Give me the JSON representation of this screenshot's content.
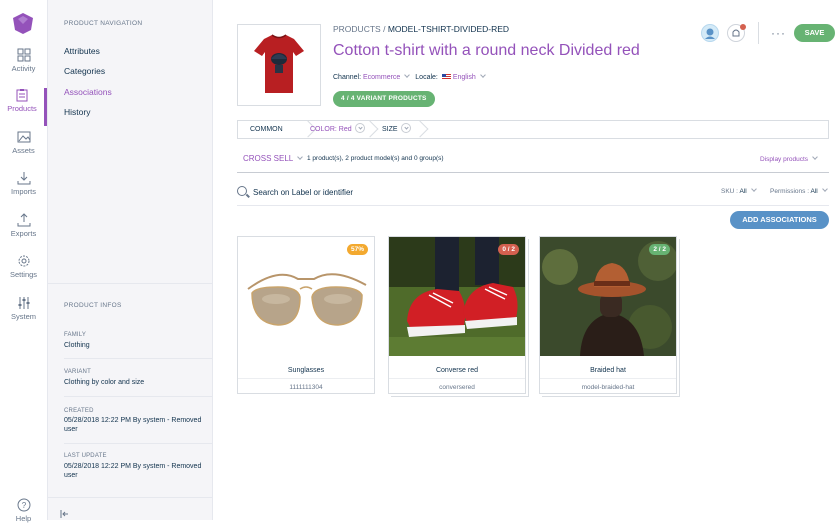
{
  "rail": {
    "items": [
      {
        "label": "Activity"
      },
      {
        "label": "Products"
      },
      {
        "label": "Assets"
      },
      {
        "label": "Imports"
      },
      {
        "label": "Exports"
      },
      {
        "label": "Settings"
      },
      {
        "label": "System"
      }
    ],
    "help": "Help"
  },
  "sidebar": {
    "nav_title": "PRODUCT NAVIGATION",
    "nav": [
      "Attributes",
      "Categories",
      "Associations",
      "History"
    ],
    "infos_title": "PRODUCT INFOS",
    "infos": [
      {
        "label": "FAMILY",
        "value": "Clothing"
      },
      {
        "label": "VARIANT",
        "value": "Clothing by color and size"
      },
      {
        "label": "CREATED",
        "value": "05/28/2018 12:22 PM By system - Removed user"
      },
      {
        "label": "LAST UPDATE",
        "value": "05/28/2018 12:22 PM By system - Removed user"
      }
    ]
  },
  "header": {
    "breadcrumb_root": "PRODUCTS",
    "breadcrumb_sep": "/",
    "breadcrumb_current": "MODEL-TSHIRT-DIVIDED-RED",
    "title": "Cotton t-shirt with a round neck Divided red",
    "channel_label": "Channel:",
    "channel_value": "Ecommerce",
    "locale_label": "Locale:",
    "locale_value": "English",
    "variant_badge": "4 / 4 VARIANT PRODUCTS",
    "save_label": "SAVE",
    "more_label": "···"
  },
  "axes": {
    "common": "COMMON",
    "color": "COLOR: Red",
    "size": "SIZE"
  },
  "associations": {
    "type": "CROSS SELL",
    "count": "1 product(s), 2 product model(s) and 0 group(s)",
    "display": "Display products",
    "search_placeholder": "Search on Label or identifier",
    "sku_filter_label": "SKU :",
    "sku_filter_value": "All",
    "perm_filter_label": "Permissions :",
    "perm_filter_value": "All",
    "add_label": "ADD ASSOCIATIONS"
  },
  "cards": [
    {
      "name": "Sunglasses",
      "code": "1111111304",
      "badge": "57%",
      "badge_color": "#f3a92f"
    },
    {
      "name": "Converse red",
      "code": "conversered",
      "badge": "0 / 2",
      "badge_color": "#d4604f"
    },
    {
      "name": "Braided hat",
      "code": "model-braided-hat",
      "badge": "2 / 2",
      "badge_color": "#67b373"
    }
  ],
  "colors": {
    "accent": "#9452ba",
    "green": "#67b373",
    "blue": "#5992c7"
  }
}
